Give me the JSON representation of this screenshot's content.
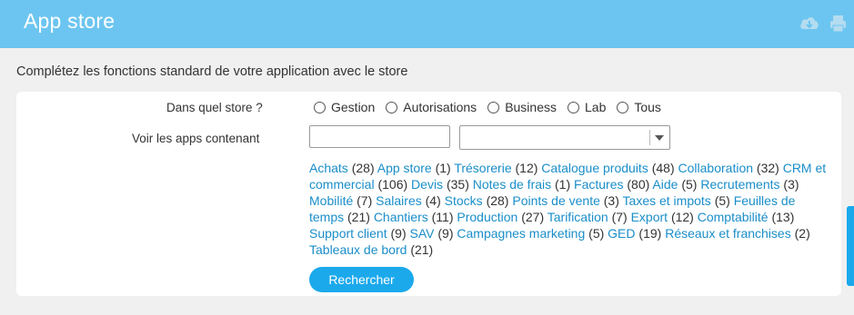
{
  "header": {
    "title": "App store",
    "icons": [
      "cloud-download-icon",
      "print-icon"
    ]
  },
  "intro": "Complétez les fonctions standard de votre application avec le store",
  "store_filter": {
    "label": "Dans quel store ?",
    "options": [
      "Gestion",
      "Autorisations",
      "Business",
      "Lab",
      "Tous"
    ]
  },
  "search": {
    "label": "Voir les apps contenant",
    "text_value": "",
    "select_value": ""
  },
  "categories": [
    {
      "name": "Achats",
      "count": "(28)"
    },
    {
      "name": "App store",
      "count": "(1)"
    },
    {
      "name": "Trésorerie",
      "count": "(12)"
    },
    {
      "name": "Catalogue produits",
      "count": "(48)"
    },
    {
      "name": "Collaboration",
      "count": "(32)"
    },
    {
      "name": "CRM et commercial",
      "count": "(106)"
    },
    {
      "name": "Devis",
      "count": "(35)"
    },
    {
      "name": "Notes de frais",
      "count": "(1)"
    },
    {
      "name": "Factures",
      "count": "(80)"
    },
    {
      "name": "Aide",
      "count": "(5)"
    },
    {
      "name": "Recrutements",
      "count": "(3)"
    },
    {
      "name": "Mobilité",
      "count": "(7)"
    },
    {
      "name": "Salaires",
      "count": "(4)"
    },
    {
      "name": "Stocks",
      "count": "(28)"
    },
    {
      "name": "Points de vente",
      "count": "(3)"
    },
    {
      "name": "Taxes et impots",
      "count": "(5)"
    },
    {
      "name": "Feuilles de temps",
      "count": "(21)"
    },
    {
      "name": "Chantiers",
      "count": "(11)"
    },
    {
      "name": "Production",
      "count": "(27)"
    },
    {
      "name": "Tarification",
      "count": "(7)"
    },
    {
      "name": "Export",
      "count": "(12)"
    },
    {
      "name": "Comptabilité",
      "count": "(13)"
    },
    {
      "name": "Support client",
      "count": "(9)"
    },
    {
      "name": "SAV",
      "count": "(9)"
    },
    {
      "name": "Campagnes marketing",
      "count": "(5)"
    },
    {
      "name": "GED",
      "count": "(19)"
    },
    {
      "name": "Réseaux et franchises",
      "count": "(2)"
    },
    {
      "name": "Tableaux de bord",
      "count": "(21)"
    }
  ],
  "search_button": "Rechercher",
  "colors": {
    "header": "#6cc5f0",
    "link": "#1a8ec9",
    "button": "#1ba9ec"
  }
}
